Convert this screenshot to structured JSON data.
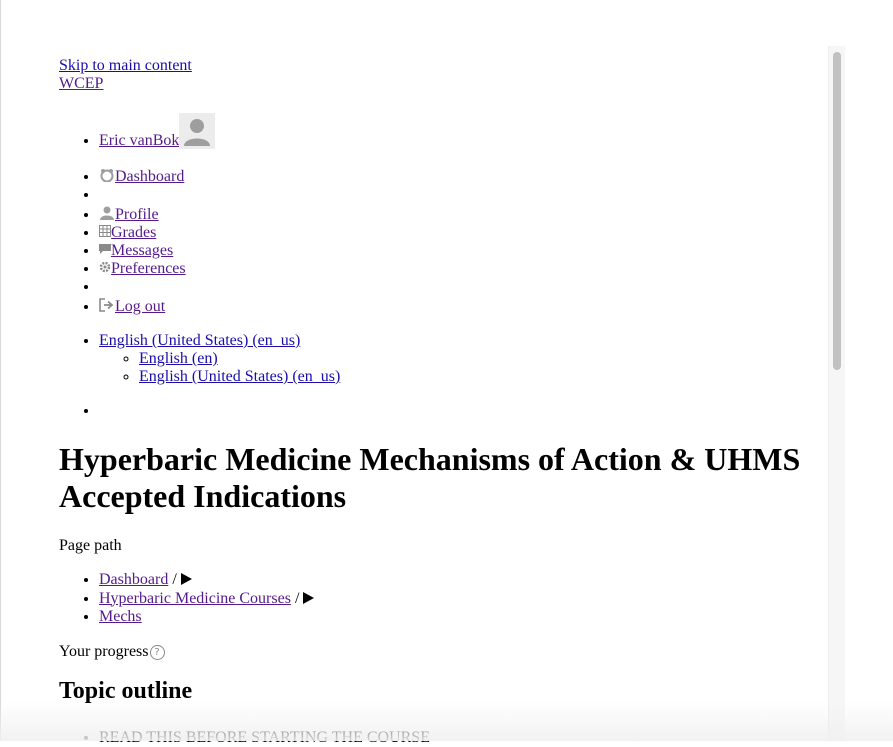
{
  "skip_link": "Skip to main content",
  "site_name": "WCEP",
  "user_menu": {
    "user_name": "Eric vanBok",
    "items": {
      "dashboard": "Dashboard",
      "profile": "Profile",
      "grades": "Grades",
      "messages": "Messages",
      "preferences": "Preferences",
      "logout": "Log out"
    }
  },
  "language": {
    "current": "English (United States) (en_us)",
    "options": [
      "English (en)",
      "English (United States) (en_us)"
    ]
  },
  "page_title": "Hyperbaric Medicine Mechanisms of Action & UHMS Accepted Indications",
  "breadcrumb": {
    "label": "Page path",
    "items": [
      "Dashboard",
      "Hyperbaric Medicine Courses",
      "Mechs"
    ],
    "separator": "/"
  },
  "progress_label": "Your progress",
  "section_heading": "Topic outline",
  "topics": [
    "READ THIS BEFORE STARTING THE COURSE"
  ],
  "icons": {
    "avatar": "user-avatar-icon",
    "dashboard": "dashboard-icon",
    "profile": "user-icon",
    "grades": "grid-table-icon",
    "messages": "speech-bubble-icon",
    "preferences": "gear-icon",
    "logout": "sign-out-icon",
    "help": "help-icon"
  }
}
